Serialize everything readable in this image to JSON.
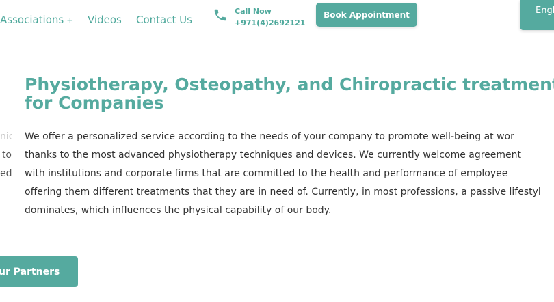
{
  "nav": {
    "items": [
      {
        "label": "Associations",
        "suffix": "+"
      },
      {
        "label": "Videos"
      },
      {
        "label": "Contact Us"
      }
    ],
    "call": {
      "label": "Call Now",
      "number": "+971(4)2692121"
    },
    "book_label": "Book Appointment",
    "lang_label": "Engl"
  },
  "main": {
    "heading_lines": [
      "Physiotherapy, Osteopathy, and Chiropractic treatment",
      "for Companies"
    ],
    "side_fragments": [
      "nic",
      "to",
      "ed,"
    ],
    "body_lines": [
      "We offer a personalized service according to the needs of your company to promote well-being at wor",
      "thanks to the most advanced physiotherapy techniques and devices. We currently welcome agreement",
      "with institutions and corporate firms that are committed to the health and performance of employee",
      "offering them different treatments that they are in need of. Currently, in most professions, a passive lifestyl",
      "dominates, which influences the physical capability of our body."
    ],
    "partners_label": "ur Partners"
  },
  "colors": {
    "accent": "#55aa9f",
    "text": "#333333"
  }
}
